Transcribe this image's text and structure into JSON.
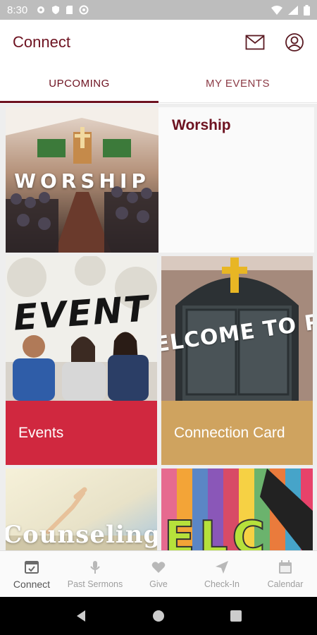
{
  "status_bar": {
    "time": "8:30"
  },
  "app_bar": {
    "title": "Connect"
  },
  "tabs": [
    {
      "label": "UPCOMING",
      "active": true
    },
    {
      "label": "MY EVENTS",
      "active": false
    }
  ],
  "cards": [
    {
      "title": "Worship",
      "image_text": "WORSHIP"
    },
    {
      "title": "Events",
      "image_text": "EVENT",
      "banner_color": "#d0283f"
    },
    {
      "title": "Connection Card",
      "image_text": "ELCOME TO P",
      "banner_color": "#cfa35f"
    },
    {
      "title": "",
      "image_text": "Counseling"
    },
    {
      "title": "",
      "image_text": "ELC"
    }
  ],
  "bottom_nav": [
    {
      "label": "Connect",
      "icon": "calendar-check-icon",
      "active": true
    },
    {
      "label": "Past Sermons",
      "icon": "microphone-icon",
      "active": false
    },
    {
      "label": "Give",
      "icon": "heart-icon",
      "active": false
    },
    {
      "label": "Check-In",
      "icon": "send-icon",
      "active": false
    },
    {
      "label": "Calendar",
      "icon": "calendar-icon",
      "active": false
    }
  ],
  "colors": {
    "brand": "#6d1220",
    "events": "#d0283f",
    "connection": "#cfa35f"
  }
}
